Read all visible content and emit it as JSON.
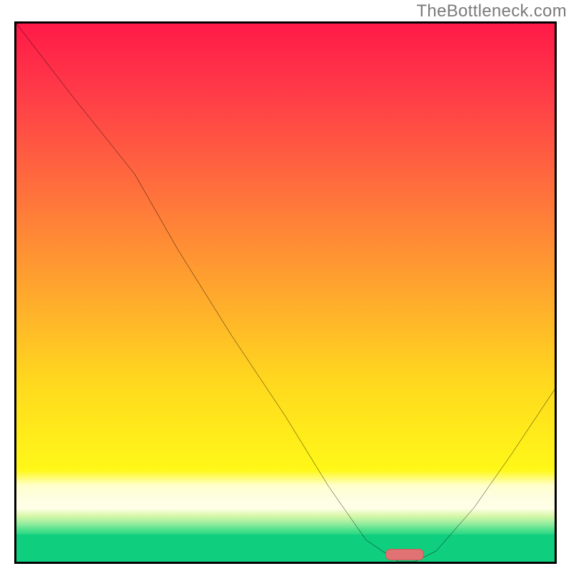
{
  "watermark": "TheBottleneck.com",
  "chart_data": {
    "type": "line",
    "title": "",
    "xlabel": "",
    "ylabel": "",
    "xlim": [
      0,
      100
    ],
    "ylim": [
      0,
      100
    ],
    "x": [
      0,
      10,
      18,
      22,
      30,
      40,
      50,
      58,
      65,
      71,
      74,
      78,
      85,
      92,
      100
    ],
    "values": [
      100,
      87,
      77,
      72,
      58,
      42,
      27,
      14,
      4,
      0,
      0,
      2,
      10,
      20,
      32
    ],
    "marker": {
      "x_fraction": 0.72,
      "y_fraction": 0.005,
      "color": "#e07273"
    },
    "background_gradient": {
      "stops": [
        {
          "pos": 0.0,
          "color": "#ff1a48"
        },
        {
          "pos": 0.5,
          "color": "#ff8f34"
        },
        {
          "pos": 0.83,
          "color": "#fff818"
        },
        {
          "pos": 0.9,
          "color": "#ffffe8"
        },
        {
          "pos": 0.95,
          "color": "#25d785"
        },
        {
          "pos": 1.0,
          "color": "#0fcf7f"
        }
      ]
    }
  },
  "colors": {
    "curve": "#000000",
    "marker": "#e07273",
    "frame": "#000000",
    "watermark": "#7a7a7a"
  }
}
